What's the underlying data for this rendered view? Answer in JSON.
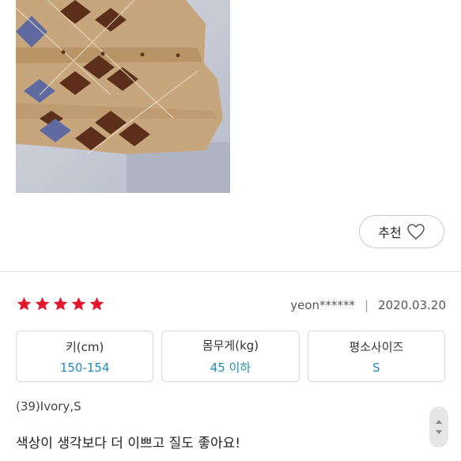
{
  "product_image": {
    "alt": "argyle-knit-vest-photo"
  },
  "recommend": {
    "label": "추천",
    "icon": "heart-outline-icon"
  },
  "review": {
    "rating": 5,
    "rating_max": 5,
    "author": "yeon******",
    "separator": "|",
    "date": "2020.03.20",
    "specs": [
      {
        "key": "키(cm)",
        "value": "150-154"
      },
      {
        "key": "몸무게(kg)",
        "value": "45 이하"
      },
      {
        "key": "평소사이즈",
        "value": "S"
      }
    ],
    "option": "(39)Ivory,S",
    "text": "색상이 생각보다 더 이쁘고 질도 좋아요!"
  },
  "colors": {
    "star": "#e4162c",
    "spec_value": "#1f8ab8"
  }
}
